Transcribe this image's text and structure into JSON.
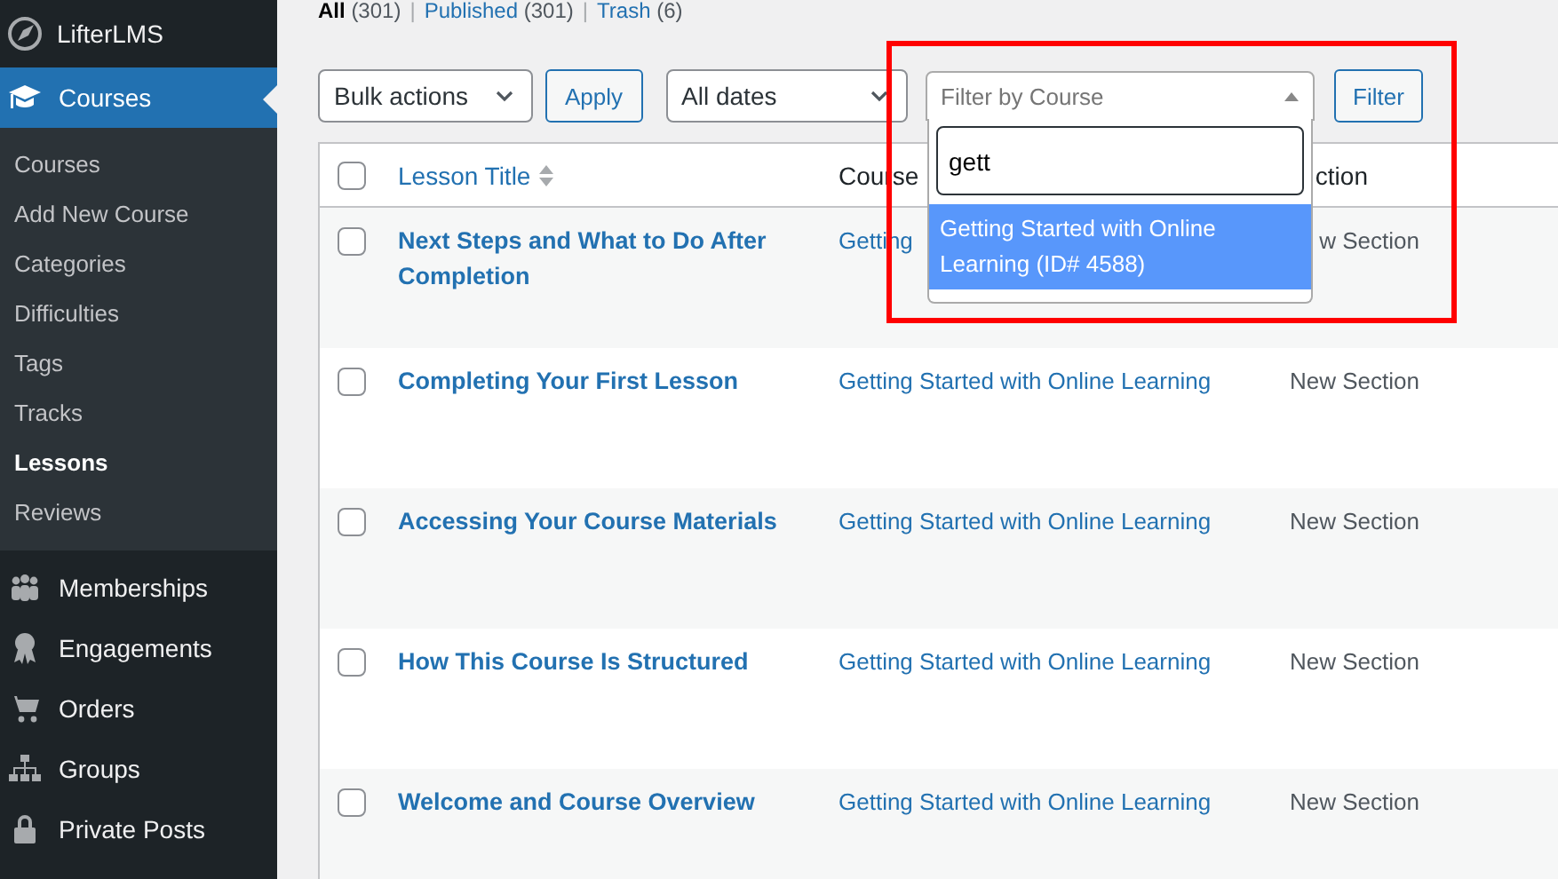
{
  "sidebar": {
    "brand": "LifterLMS",
    "menu": [
      {
        "label": "Courses",
        "selected": true,
        "children": [
          {
            "label": "Courses",
            "selected": false
          },
          {
            "label": "Add New Course",
            "selected": false
          },
          {
            "label": "Categories",
            "selected": false
          },
          {
            "label": "Difficulties",
            "selected": false
          },
          {
            "label": "Tags",
            "selected": false
          },
          {
            "label": "Tracks",
            "selected": false
          },
          {
            "label": "Lessons",
            "selected": true
          },
          {
            "label": "Reviews",
            "selected": false
          }
        ]
      },
      {
        "label": "Memberships",
        "selected": false
      },
      {
        "label": "Engagements",
        "selected": false
      },
      {
        "label": "Orders",
        "selected": false
      },
      {
        "label": "Groups",
        "selected": false
      },
      {
        "label": "Private Posts",
        "selected": false
      }
    ]
  },
  "views": [
    {
      "label": "All",
      "count": "(301)",
      "selected": true,
      "separator": "|"
    },
    {
      "label": "Published",
      "count": "(301)",
      "selected": false,
      "separator": "|"
    },
    {
      "label": "Trash",
      "count": "(6)",
      "selected": false
    }
  ],
  "toolbar": {
    "bulk_actions": "Bulk actions",
    "apply": "Apply",
    "dates": "All dates",
    "course_filter": {
      "placeholder": "Filter by Course",
      "search": "gett",
      "options": [
        {
          "label": "Getting Started with Online Learning (ID# 4588)",
          "selected": true
        }
      ]
    },
    "filter": "Filter"
  },
  "table": {
    "select_all": {
      "checked": false
    },
    "columns": [
      {
        "label": "Lesson Title"
      },
      {
        "label": "Course"
      },
      {
        "label": "ction"
      }
    ],
    "rows": [
      {
        "checked": false,
        "title": "Next Steps and What to Do After Completion",
        "course": "Getting",
        "section": "w Section"
      },
      {
        "checked": false,
        "title": "Completing Your First Lesson",
        "course": "Getting Started with Online Learning",
        "section": "New Section"
      },
      {
        "checked": false,
        "title": "Accessing Your Course Materials",
        "course": "Getting Started with Online Learning",
        "section": "New Section"
      },
      {
        "checked": false,
        "title": "How This Course Is Structured",
        "course": "Getting Started with Online Learning",
        "section": "New Section"
      },
      {
        "checked": false,
        "title": "Welcome and Course Overview",
        "course": "Getting Started with Online Learning",
        "section": "New Section"
      }
    ]
  }
}
